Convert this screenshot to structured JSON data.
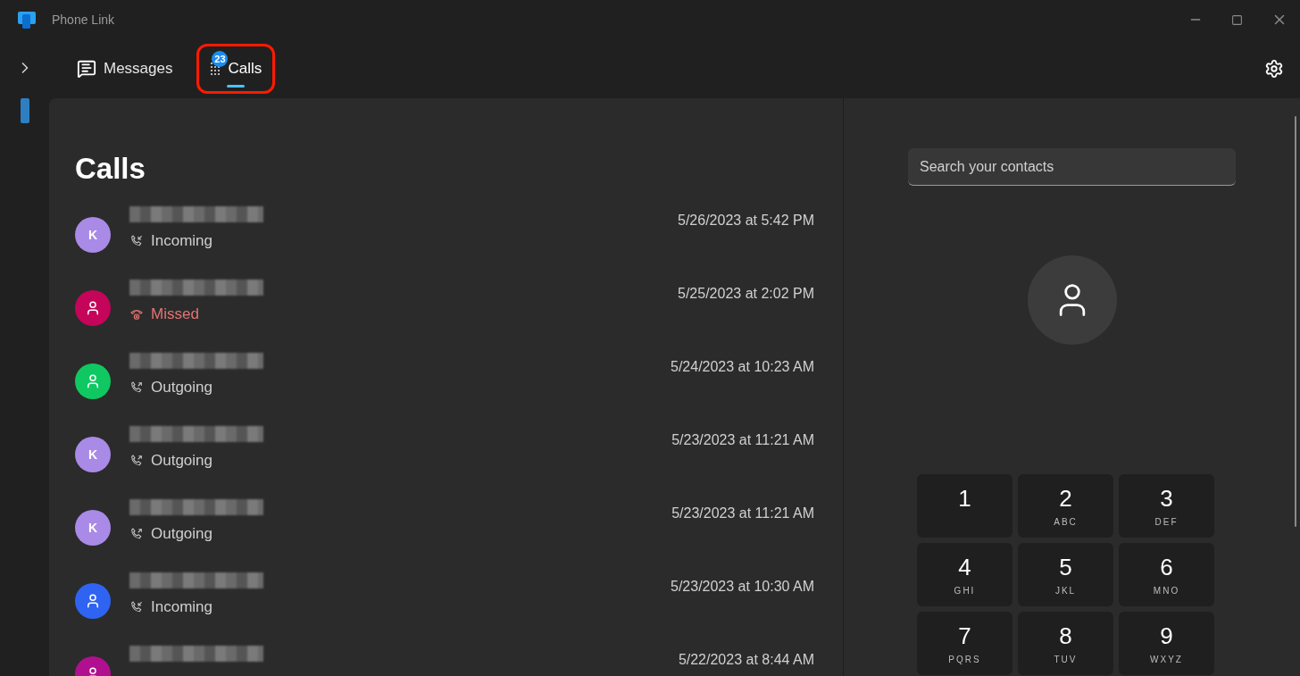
{
  "window": {
    "title": "Phone Link"
  },
  "tabs": [
    {
      "kind": "messages",
      "label": "Messages",
      "selected": false,
      "highlighted": false
    },
    {
      "kind": "calls",
      "label": "Calls",
      "selected": true,
      "badge": "23",
      "highlighted": true
    }
  ],
  "calls": {
    "title": "Calls",
    "rows": [
      {
        "avatar": {
          "kind": "initial",
          "initial": "K",
          "color": "#a98ae6"
        },
        "direction": {
          "kind": "incoming",
          "label": "Incoming"
        },
        "time": "5/26/2023 at 5:42 PM"
      },
      {
        "avatar": {
          "kind": "person",
          "color": "#c4055a"
        },
        "direction": {
          "kind": "missed",
          "label": "Missed"
        },
        "time": "5/25/2023 at 2:02 PM"
      },
      {
        "avatar": {
          "kind": "person",
          "color": "#10c862"
        },
        "direction": {
          "kind": "outgoing",
          "label": "Outgoing"
        },
        "time": "5/24/2023 at 10:23 AM"
      },
      {
        "avatar": {
          "kind": "initial",
          "initial": "K",
          "color": "#a98ae6"
        },
        "direction": {
          "kind": "outgoing",
          "label": "Outgoing"
        },
        "time": "5/23/2023 at 11:21 AM"
      },
      {
        "avatar": {
          "kind": "initial",
          "initial": "K",
          "color": "#a98ae6"
        },
        "direction": {
          "kind": "outgoing",
          "label": "Outgoing"
        },
        "time": "5/23/2023 at 11:21 AM"
      },
      {
        "avatar": {
          "kind": "person",
          "color": "#2f64f2"
        },
        "direction": {
          "kind": "incoming",
          "label": "Incoming"
        },
        "time": "5/23/2023 at 10:30 AM"
      },
      {
        "avatar": {
          "kind": "person",
          "color": "#b0108f"
        },
        "time": "5/22/2023 at 8:44 AM"
      }
    ]
  },
  "dialer": {
    "search": {
      "placeholder": "Search your contacts"
    },
    "keys": [
      {
        "digit": "1"
      },
      {
        "digit": "2",
        "letters": "ABC"
      },
      {
        "digit": "3",
        "letters": "DEF"
      },
      {
        "digit": "4",
        "letters": "GHI"
      },
      {
        "digit": "5",
        "letters": "JKL"
      },
      {
        "digit": "6",
        "letters": "MNO"
      },
      {
        "digit": "7",
        "letters": "PQRS"
      },
      {
        "digit": "8",
        "letters": "TUV"
      },
      {
        "digit": "9",
        "letters": "WXYZ"
      }
    ]
  }
}
